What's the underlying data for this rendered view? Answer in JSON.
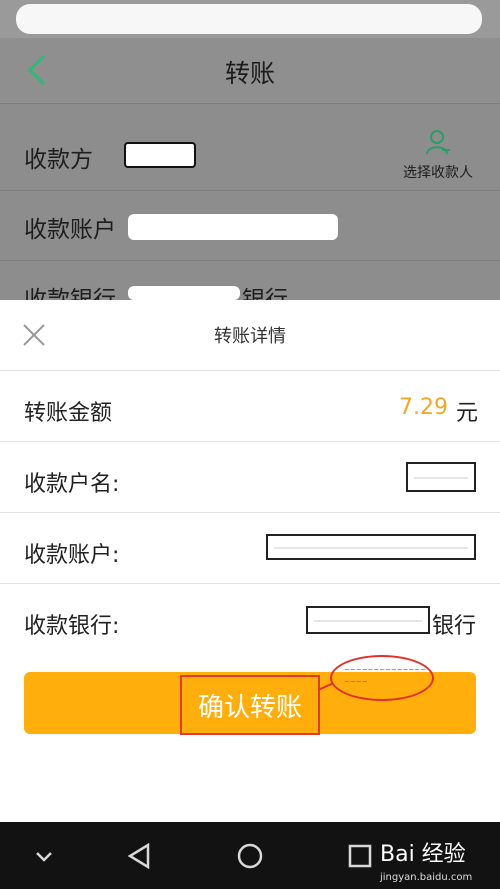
{
  "header": {
    "title": "转账"
  },
  "form": {
    "payee_label": "收款方",
    "choose_payee_label": "选择收款人",
    "account_label": "收款账户",
    "bank_label": "收款银行",
    "bank_suffix": "银行"
  },
  "sheet": {
    "title": "转账详情",
    "amount_label": "转账金额",
    "amount_value": "7.29",
    "amount_unit": "元",
    "name_label": "收款户名:",
    "account_label": "收款账户:",
    "bank_label": "收款银行:",
    "bank_suffix": "银行",
    "confirm_label": "确认转账"
  },
  "watermark": {
    "brand": "Bai 经验",
    "url": "jingyan.baidu.com"
  },
  "colors": {
    "accent": "#ffae0c",
    "amount": "#f5a623",
    "back_icon": "#2eb87a",
    "annotation": "#e0322b"
  }
}
